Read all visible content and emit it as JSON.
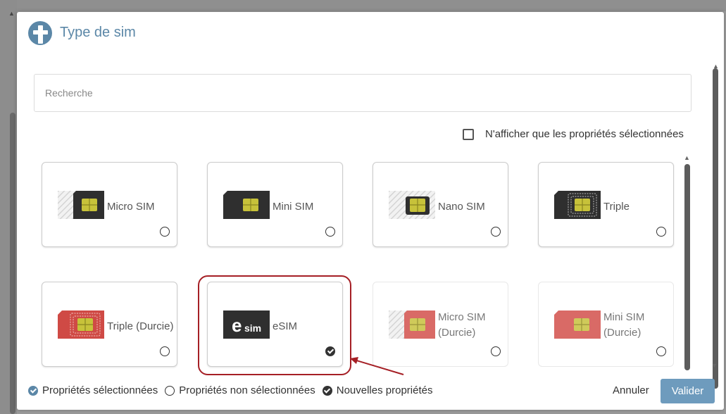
{
  "dialog": {
    "title": "Type de sim"
  },
  "search": {
    "placeholder": "Recherche",
    "value": ""
  },
  "filter": {
    "label": "N'afficher que les propriétés sélectionnées",
    "checked": false
  },
  "cards": [
    {
      "label": "Micro SIM",
      "icon": "micro-sim-icon",
      "selected": false,
      "faded": false
    },
    {
      "label": "Mini SIM",
      "icon": "mini-sim-icon",
      "selected": false,
      "faded": false
    },
    {
      "label": "Nano SIM",
      "icon": "nano-sim-icon",
      "selected": false,
      "faded": false
    },
    {
      "label": "Triple",
      "icon": "triple-sim-icon",
      "selected": false,
      "faded": false
    },
    {
      "label": "Triple (Durcie)",
      "icon": "triple-durcie-sim-icon",
      "selected": false,
      "faded": false
    },
    {
      "label": "eSIM",
      "icon": "esim-icon",
      "selected": true,
      "faded": false
    },
    {
      "label": "Micro SIM (Durcie)",
      "icon": "micro-sim-durcie-icon",
      "selected": false,
      "faded": true
    },
    {
      "label": "Mini SIM (Durcie)",
      "icon": "mini-sim-durcie-icon",
      "selected": false,
      "faded": true
    }
  ],
  "esim_logo": {
    "big": "e",
    "small": "sim"
  },
  "legend": {
    "selected": "Propriétés sélectionnées",
    "not_selected": "Propriétés non sélectionnées",
    "new": "Nouvelles propriétés"
  },
  "actions": {
    "cancel": "Annuler",
    "validate": "Valider"
  },
  "colors": {
    "accent": "#5b87a7",
    "button": "#6e9bbd",
    "highlight": "#a51f25",
    "chip": "#c7c23a",
    "sim_dark": "#2f2f2f",
    "sim_red": "#cf4a45"
  }
}
